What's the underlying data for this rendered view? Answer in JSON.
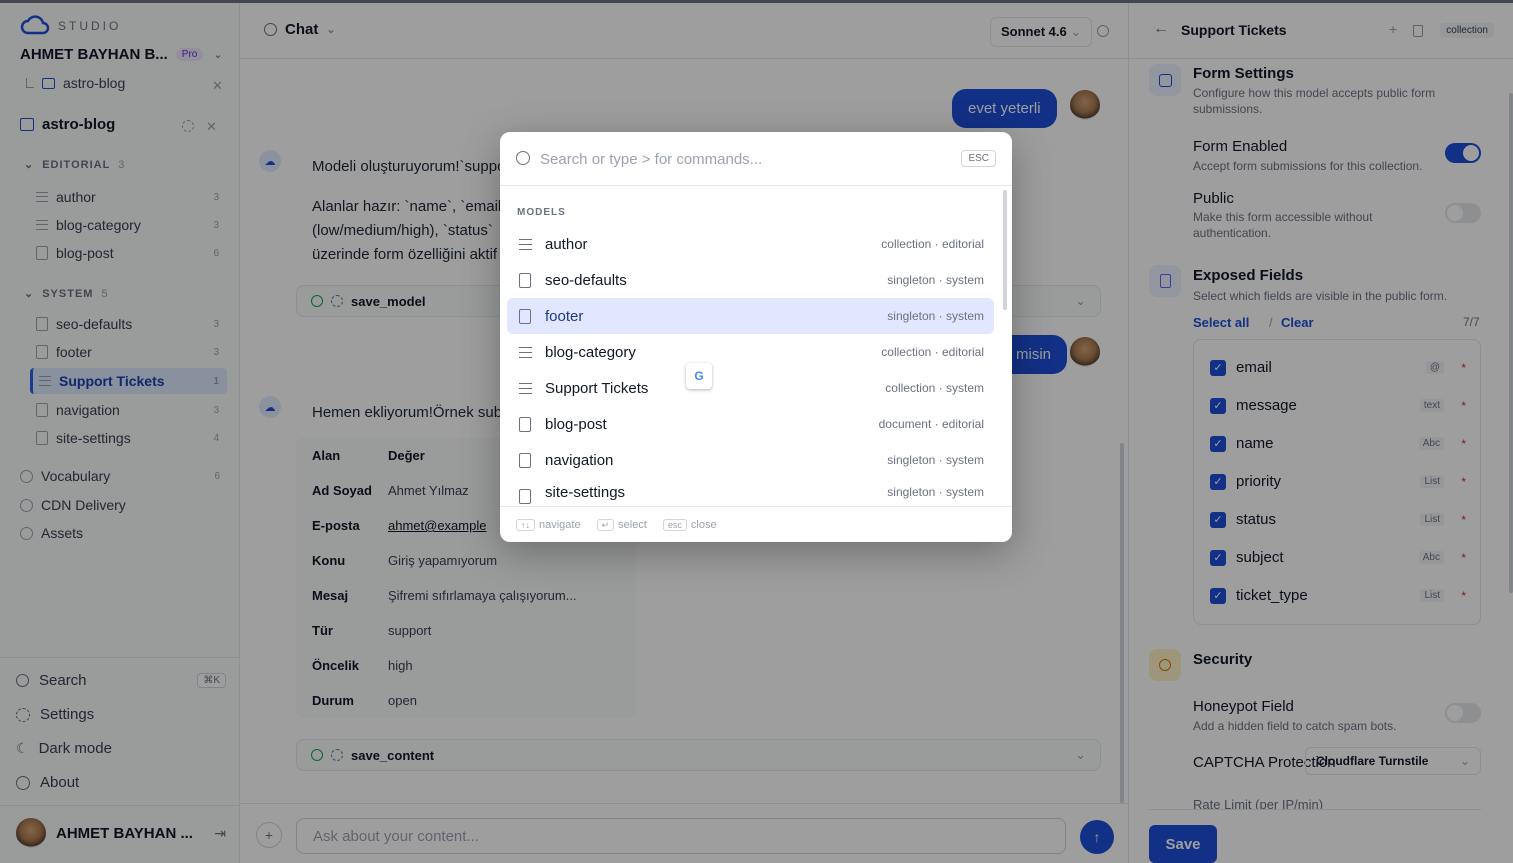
{
  "sidebar": {
    "brand": "STUDIO",
    "workspace": "AHMET BAYHAN B...",
    "plan": "Pro",
    "breadcrumb_project": "astro-blog",
    "project": "astro-blog",
    "sections": [
      {
        "label": "EDITORIAL",
        "count": "3"
      },
      {
        "label": "SYSTEM",
        "count": "5"
      }
    ],
    "editorial_items": [
      {
        "label": "author",
        "count": "3"
      },
      {
        "label": "blog-category",
        "count": "3"
      },
      {
        "label": "blog-post",
        "count": "6"
      }
    ],
    "system_items": [
      {
        "label": "seo-defaults",
        "count": "3"
      },
      {
        "label": "footer",
        "count": "3"
      },
      {
        "label": "Support Tickets",
        "count": "1"
      },
      {
        "label": "navigation",
        "count": "3"
      },
      {
        "label": "site-settings",
        "count": "4"
      }
    ],
    "extra": [
      {
        "label": "Vocabulary",
        "count": "6"
      },
      {
        "label": "CDN Delivery",
        "count": ""
      },
      {
        "label": "Assets",
        "count": ""
      }
    ],
    "bottom": {
      "search": "Search",
      "search_kbd": "⌘K",
      "settings": "Settings",
      "dark_mode": "Dark mode",
      "about": "About"
    },
    "user_name": "AHMET BAYHAN ..."
  },
  "chat": {
    "title": "Chat",
    "model": "Sonnet 4.6",
    "user_msg_1": "evet yeterli",
    "ai_msg_1_line1": "Modeli oluşturuyorum!`suppo",
    "ai_msg_1_line2": "Alanlar hazır: `name`, `email`",
    "ai_msg_1_line3": "(low/medium/high), `status`",
    "ai_msg_1_line4": "üzerinde form özelliğini aktif",
    "tool_1": "save_model",
    "user_msg_2": "misin",
    "ai_msg_2": "Hemen ekliyorum!Örnek sub",
    "table_head": {
      "k": "Alan",
      "v": "Değer"
    },
    "table_rows": [
      {
        "k": "Ad Soyad",
        "v": "Ahmet Yılmaz"
      },
      {
        "k": "E-posta",
        "v": "ahmet@example"
      },
      {
        "k": "Konu",
        "v": "Giriş yapamıyorum"
      },
      {
        "k": "Mesaj",
        "v": "Şifremi sıfırlamaya çalışıyorum..."
      },
      {
        "k": "Tür",
        "v": "support"
      },
      {
        "k": "Öncelik",
        "v": "high"
      },
      {
        "k": "Durum",
        "v": "open"
      }
    ],
    "tool_2": "save_content",
    "input_placeholder": "Ask about your content..."
  },
  "panel": {
    "title": "Support Tickets",
    "tag": "collection",
    "form_settings": "Form Settings",
    "form_settings_desc": "Configure how this model accepts public form submissions.",
    "form_enabled": "Form Enabled",
    "form_enabled_desc": "Accept form submissions for this collection.",
    "public": "Public",
    "public_desc": "Make this form accessible without authentication.",
    "exposed_fields": "Exposed Fields",
    "exposed_fields_desc": "Select which fields are visible in the public form.",
    "select_all": "Select all",
    "sep": "/",
    "clear": "Clear",
    "count": "7/7",
    "fields": [
      {
        "name": "email",
        "type": "@"
      },
      {
        "name": "message",
        "type": "text"
      },
      {
        "name": "name",
        "type": "Abc"
      },
      {
        "name": "priority",
        "type": "List"
      },
      {
        "name": "status",
        "type": "List"
      },
      {
        "name": "subject",
        "type": "Abc"
      },
      {
        "name": "ticket_type",
        "type": "List"
      }
    ],
    "required_mark": "*",
    "security": "Security",
    "honeypot": "Honeypot Field",
    "honeypot_desc": "Add a hidden field to catch spam bots.",
    "captcha": "CAPTCHA Protection",
    "captcha_value": "Cloudflare Turnstile",
    "rate_limit": "Rate Limit (per IP/min)",
    "save": "Save"
  },
  "palette": {
    "placeholder": "Search or type > for commands...",
    "esc": "ESC",
    "section": "MODELS",
    "items": [
      {
        "label": "author",
        "meta": "collection · editorial",
        "icon": "list-icon"
      },
      {
        "label": "seo-defaults",
        "meta": "singleton · system",
        "icon": "document-icon"
      },
      {
        "label": "footer",
        "meta": "singleton · system",
        "icon": "document-icon"
      },
      {
        "label": "blog-category",
        "meta": "collection · editorial",
        "icon": "list-icon"
      },
      {
        "label": "Support Tickets",
        "meta": "collection · system",
        "icon": "list-icon"
      },
      {
        "label": "blog-post",
        "meta": "document · editorial",
        "icon": "document-icon"
      },
      {
        "label": "navigation",
        "meta": "singleton · system",
        "icon": "document-icon"
      },
      {
        "label": "site-settings",
        "meta": "singleton · system",
        "icon": "document-icon"
      }
    ],
    "foot": {
      "nav_key": "↑↓",
      "nav": "navigate",
      "sel_key": "↵",
      "sel": "select",
      "esc_key": "esc",
      "close": "close"
    }
  },
  "colors": {
    "accent": "#1d4ed8",
    "selected": "#e0e7ff"
  }
}
